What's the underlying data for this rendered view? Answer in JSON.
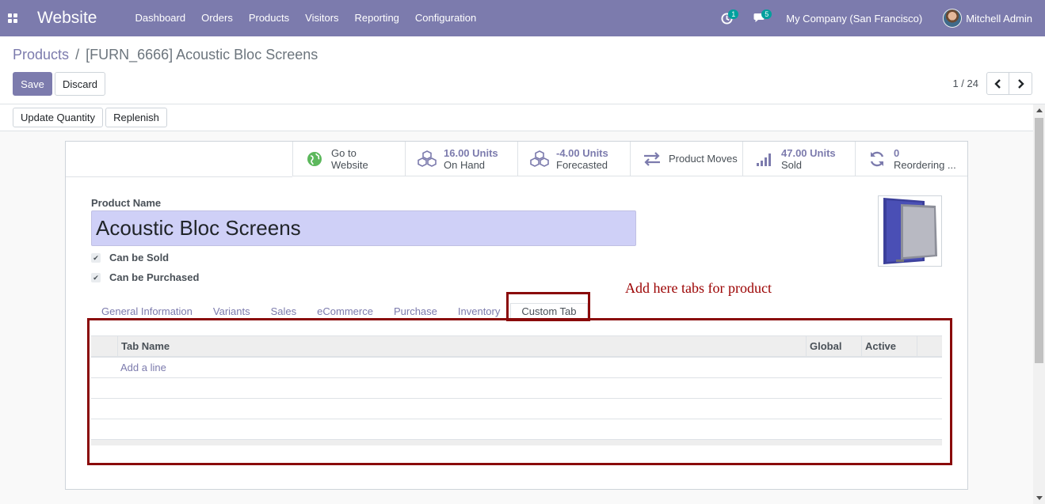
{
  "navbar": {
    "app_name": "Website",
    "menu": [
      "Dashboard",
      "Orders",
      "Products",
      "Visitors",
      "Reporting",
      "Configuration"
    ],
    "activity_count": "1",
    "messages_count": "5",
    "company": "My Company (San Francisco)",
    "user": "Mitchell Admin"
  },
  "breadcrumb": {
    "parent": "Products",
    "separator": "/",
    "current": "[FURN_6666] Acoustic Bloc Screens"
  },
  "actions": {
    "save": "Save",
    "discard": "Discard"
  },
  "pager": {
    "value": "1 / 24"
  },
  "statusbar": {
    "update_quantity": "Update Quantity",
    "replenish": "Replenish"
  },
  "smart_buttons": [
    {
      "value": "Go to",
      "label": "Website",
      "icon": "globe-icon"
    },
    {
      "value": "16.00 Units",
      "label": "On Hand",
      "icon": "cubes-icon"
    },
    {
      "value": "-4.00 Units",
      "label": "Forecasted",
      "icon": "cubes-icon"
    },
    {
      "value": "",
      "label": "Product Moves",
      "icon": "exchange-icon"
    },
    {
      "value": "47.00 Units",
      "label": "Sold",
      "icon": "signal-icon"
    },
    {
      "value": "0",
      "label": "Reordering ...",
      "icon": "refresh-icon"
    }
  ],
  "form": {
    "product_name_label": "Product Name",
    "product_name": "Acoustic Bloc Screens",
    "can_be_sold": "Can be Sold",
    "can_be_purchased": "Can be Purchased"
  },
  "tabs": [
    "General Information",
    "Variants",
    "Sales",
    "eCommerce",
    "Purchase",
    "Inventory",
    "Custom Tab"
  ],
  "active_tab": "Custom Tab",
  "list": {
    "columns": [
      "Tab Name",
      "Global",
      "Active"
    ],
    "add_line": "Add a line"
  },
  "annotation": {
    "text": "Add here tabs for product"
  },
  "colors": {
    "primary": "#7c7bad",
    "annotation": "#8a0a0a",
    "name_field": "#cfd0f7"
  }
}
